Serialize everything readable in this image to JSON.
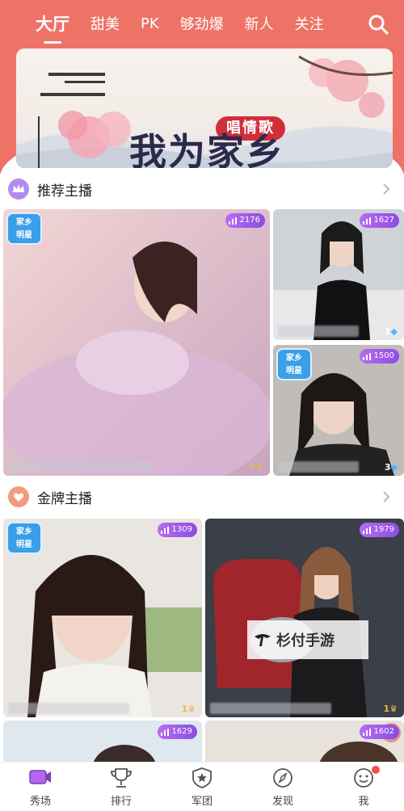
{
  "header": {
    "tabs": [
      {
        "label": "大厅",
        "active": true
      },
      {
        "label": "甜美"
      },
      {
        "label": "PK"
      },
      {
        "label": "够劲爆"
      },
      {
        "label": "新人"
      },
      {
        "label": "关注"
      }
    ],
    "accent_color": "#ee7266"
  },
  "banner": {
    "title": "我为家乡",
    "tag": "唱情歌"
  },
  "sections": {
    "recommended": {
      "title": "推荐主播",
      "icon": "crown-icon"
    },
    "gold": {
      "title": "金牌主播",
      "icon": "heart-badge-icon"
    }
  },
  "cards": [
    {
      "count": "2176",
      "level": "7",
      "level_icon": "crown",
      "hometag": [
        "家乡",
        "明星"
      ]
    },
    {
      "count": "1627",
      "level": "1",
      "level_icon": "diamond"
    },
    {
      "count": "1500",
      "level": "3",
      "level_icon": "diamond",
      "hometag": [
        "家乡",
        "明星"
      ]
    },
    {
      "count": "1309",
      "level": "1",
      "level_icon": "crown",
      "hometag": [
        "家乡",
        "明星"
      ]
    },
    {
      "count": "1979",
      "level": "1",
      "level_icon": "crown"
    },
    {
      "count": "1629"
    },
    {
      "count": "1602"
    }
  ],
  "watermark": "杉付手游",
  "nav": [
    {
      "label": "秀场",
      "icon": "video-icon",
      "active": true
    },
    {
      "label": "排行",
      "icon": "trophy-icon"
    },
    {
      "label": "军团",
      "icon": "shield-star-icon"
    },
    {
      "label": "发现",
      "icon": "compass-icon"
    },
    {
      "label": "我",
      "icon": "smiley-icon",
      "has_dot": true
    }
  ]
}
